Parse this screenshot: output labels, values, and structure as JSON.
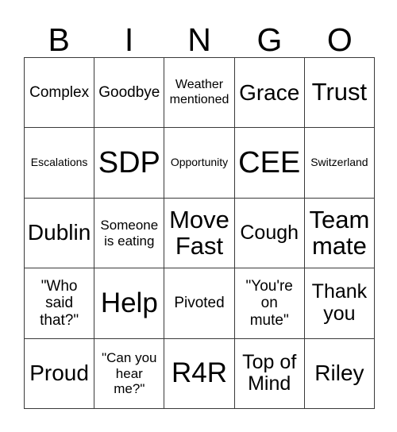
{
  "card": {
    "title": "BINGO",
    "header_letters": [
      "B",
      "I",
      "N",
      "G",
      "O"
    ],
    "grid_size": "5x5",
    "colors": {
      "background": "#ffffff",
      "text": "#000000",
      "grid_line": "#3a3a3a"
    }
  },
  "rows": [
    {
      "cells": [
        {
          "text": "Complex",
          "size": "md"
        },
        {
          "text": "Goodbye",
          "size": "md"
        },
        {
          "text": "Weather\nmentioned",
          "size": "sm"
        },
        {
          "text": "Grace",
          "size": "xl"
        },
        {
          "text": "Trust",
          "size": "2xl"
        }
      ]
    },
    {
      "cells": [
        {
          "text": "Escalations",
          "size": "xs"
        },
        {
          "text": "SDP",
          "size": "4xl"
        },
        {
          "text": "Opportunity",
          "size": "xs"
        },
        {
          "text": "CEE",
          "size": "4xl"
        },
        {
          "text": "Switzerland",
          "size": "xs"
        }
      ]
    },
    {
      "cells": [
        {
          "text": "Dublin",
          "size": "xl"
        },
        {
          "text": "Someone\nis eating",
          "size": "smb"
        },
        {
          "text": "Move\nFast",
          "size": "2xl"
        },
        {
          "text": "Cough",
          "size": "lg"
        },
        {
          "text": "Team\nmate",
          "size": "2xl"
        }
      ]
    },
    {
      "cells": [
        {
          "text": "\"Who\nsaid\nthat?\"",
          "size": "md"
        },
        {
          "text": "Help",
          "size": "3xl"
        },
        {
          "text": "Pivoted",
          "size": "md"
        },
        {
          "text": "\"You're\non\nmute\"",
          "size": "md"
        },
        {
          "text": "Thank\nyou",
          "size": "lg"
        }
      ]
    },
    {
      "cells": [
        {
          "text": "Proud",
          "size": "xl"
        },
        {
          "text": "\"Can you\nhear\nme?\"",
          "size": "smb"
        },
        {
          "text": "R4R",
          "size": "3xl"
        },
        {
          "text": "Top of\nMind",
          "size": "lg"
        },
        {
          "text": "Riley",
          "size": "xl"
        }
      ]
    }
  ]
}
